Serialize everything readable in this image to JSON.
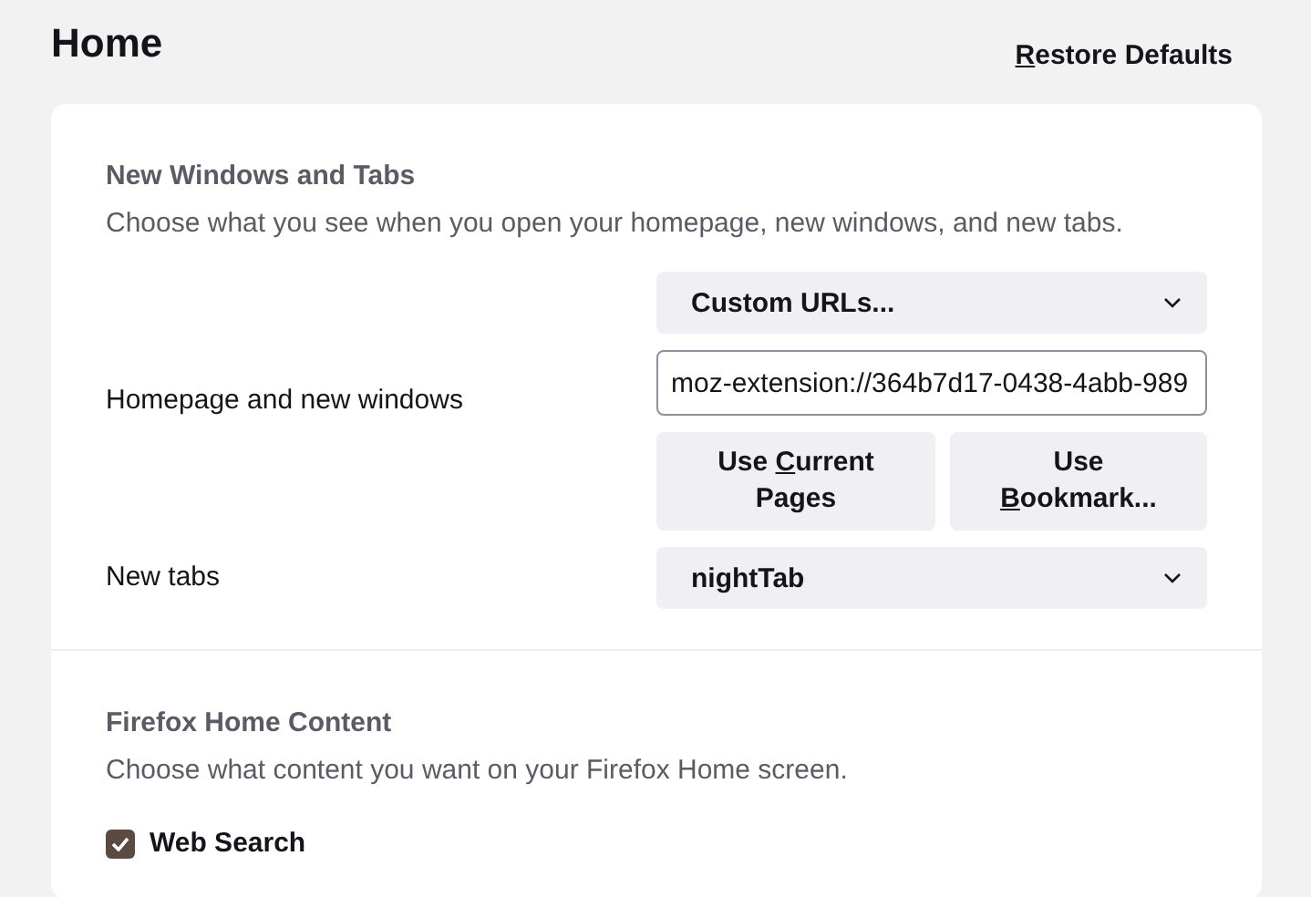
{
  "page": {
    "title": "Home",
    "restore_button": {
      "key": "R",
      "after": "estore Defaults"
    }
  },
  "sections": [
    {
      "title": "New Windows and Tabs",
      "description": "Choose what you see when you open your homepage, new windows, and new tabs.",
      "settings": [
        {
          "kind": "homepage",
          "label": "Homepage and new windows",
          "dropdown": "Custom URLs...",
          "url_value": "moz-extension://364b7d17-0438-4abb-989",
          "buttons": [
            {
              "before": "Use ",
              "key": "C",
              "after": "urrent Pages"
            },
            {
              "before": "Use ",
              "key": "B",
              "after": "ookmark..."
            }
          ]
        },
        {
          "kind": "select",
          "label": "New tabs",
          "dropdown": "nightTab"
        }
      ]
    },
    {
      "title": "Firefox Home Content",
      "description": "Choose what content you want on your Firefox Home screen.",
      "settings": [
        {
          "kind": "checkbox",
          "label": "Web Search",
          "checked": true
        }
      ]
    }
  ]
}
